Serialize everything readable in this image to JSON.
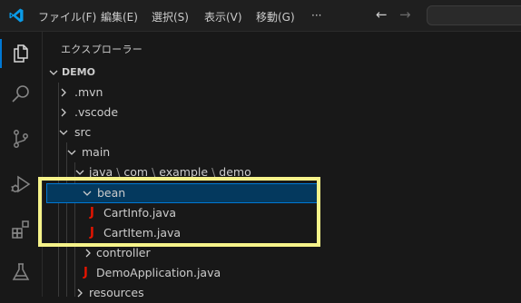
{
  "titlebar": {
    "menu": [
      "ファイル(F)",
      "編集(E)",
      "選択(S)",
      "表示(V)",
      "移動(G)",
      "···"
    ],
    "nav_back": "←",
    "nav_forward": "→"
  },
  "activity_bar": {
    "icons": [
      "files-icon",
      "search-icon",
      "source-control-icon",
      "run-debug-icon",
      "extensions-icon",
      "testing-icon"
    ]
  },
  "explorer": {
    "title": "エクスプローラー",
    "root": "DEMO",
    "tree": {
      "mvn": ".mvn",
      "vscode": ".vscode",
      "src": "src",
      "main": "main",
      "java": "java",
      "com": "com",
      "example": "example",
      "demo": "demo",
      "bean": "bean",
      "cartinfo": "CartInfo.java",
      "cartitem": "CartItem.java",
      "controller": "controller",
      "demoapp": "DemoApplication.java",
      "resources": "resources"
    },
    "java_file_glyph": "J"
  },
  "colors": {
    "selection_bg": "#04395e",
    "focus_border": "#0078d4",
    "java_icon": "#e51400",
    "highlight_box": "#f6f38a"
  }
}
